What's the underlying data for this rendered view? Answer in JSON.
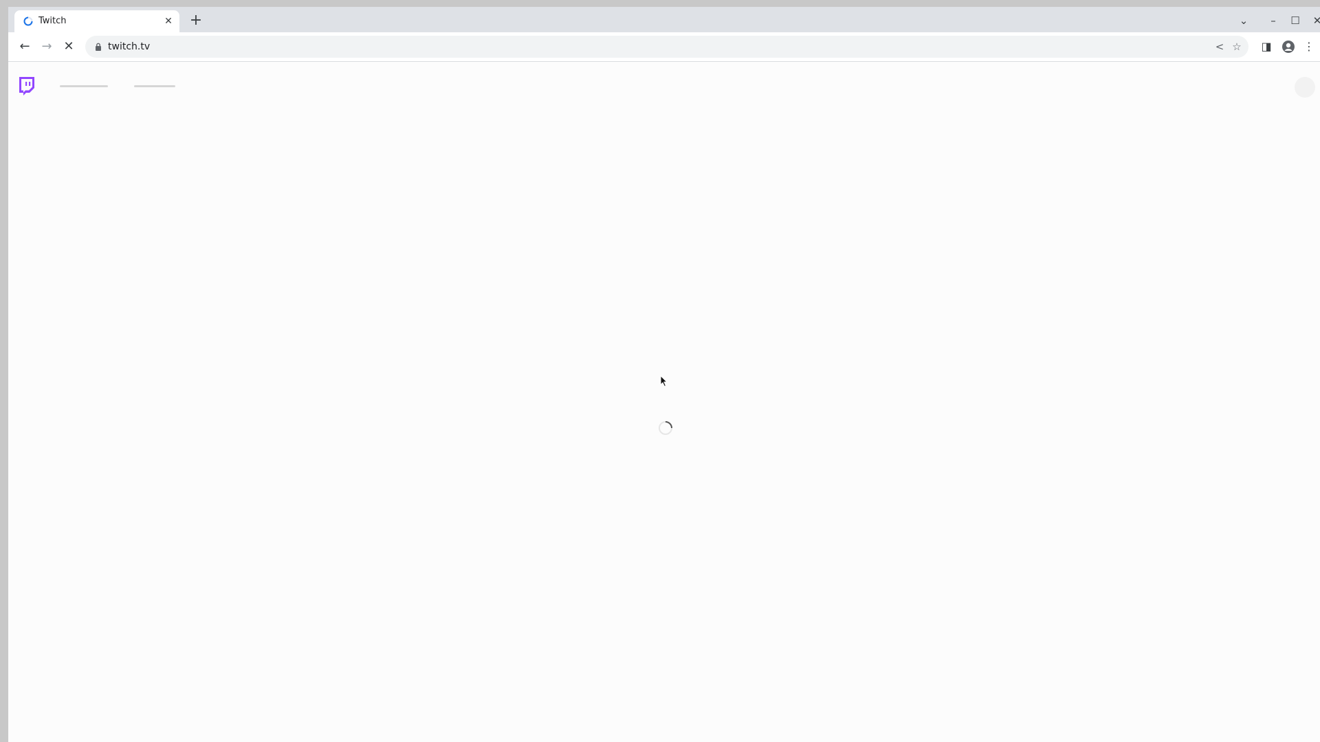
{
  "browser": {
    "tab": {
      "title": "Twitch",
      "close_label": "✕"
    },
    "new_tab_label": "+",
    "window_controls": {
      "dropdown": "⌄",
      "minimize": "–",
      "maximize": "☐",
      "close": "✕"
    },
    "toolbar": {
      "back_label": "←",
      "forward_label": "→",
      "stop_label": "✕",
      "url": "twitch.tv",
      "share_label": "<",
      "bookmark_label": "☆",
      "sidepanel_label": "◨",
      "menu_label": "⋮"
    }
  },
  "page": {
    "logo_icon": "twitch-logo-icon",
    "state": "loading",
    "accent_color": "#9146ff"
  }
}
